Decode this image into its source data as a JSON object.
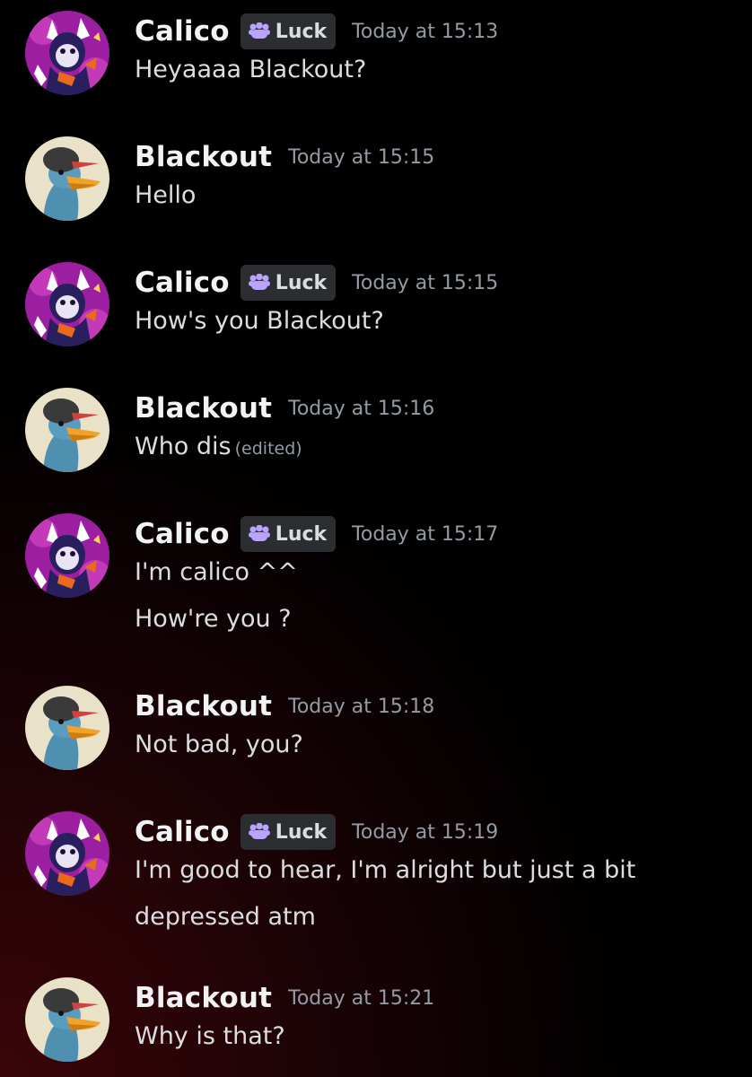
{
  "role_label": "Luck",
  "messages": [
    {
      "author": "Calico",
      "time": "Today at 15:13",
      "lines": [
        "Heyaaaa Blackout?"
      ]
    },
    {
      "author": "Blackout",
      "time": "Today at 15:15",
      "lines": [
        "Hello"
      ]
    },
    {
      "author": "Calico",
      "time": "Today at 15:15",
      "lines": [
        "How's you Blackout?"
      ]
    },
    {
      "author": "Blackout",
      "time": "Today at 15:16",
      "lines": [
        "Who dis"
      ],
      "edited": "(edited)"
    },
    {
      "author": "Calico",
      "time": "Today at 15:17",
      "lines": [
        "I'm calico ^^",
        "How're you ?"
      ]
    },
    {
      "author": "Blackout",
      "time": "Today at 15:18",
      "lines": [
        "Not bad, you?"
      ]
    },
    {
      "author": "Calico",
      "time": "Today at 15:19",
      "lines": [
        "I'm good to hear, I'm alright but just a bit",
        "depressed atm"
      ]
    },
    {
      "author": "Blackout",
      "time": "Today at 15:21",
      "lines": [
        "Why is that?"
      ]
    }
  ],
  "colors": {
    "background_dark": "#000000",
    "background_red": "#3a0508",
    "username": "#f2f3f5",
    "message_text": "#dbdee1",
    "timestamp": "#949ba4",
    "role_tag_bg": "#2b2d31",
    "role_icon": "#b9a3ff"
  },
  "icons": {
    "role": "paw-cloud-icon",
    "calico_avatar": "calico-avatar",
    "blackout_avatar": "blackout-duck-avatar"
  }
}
